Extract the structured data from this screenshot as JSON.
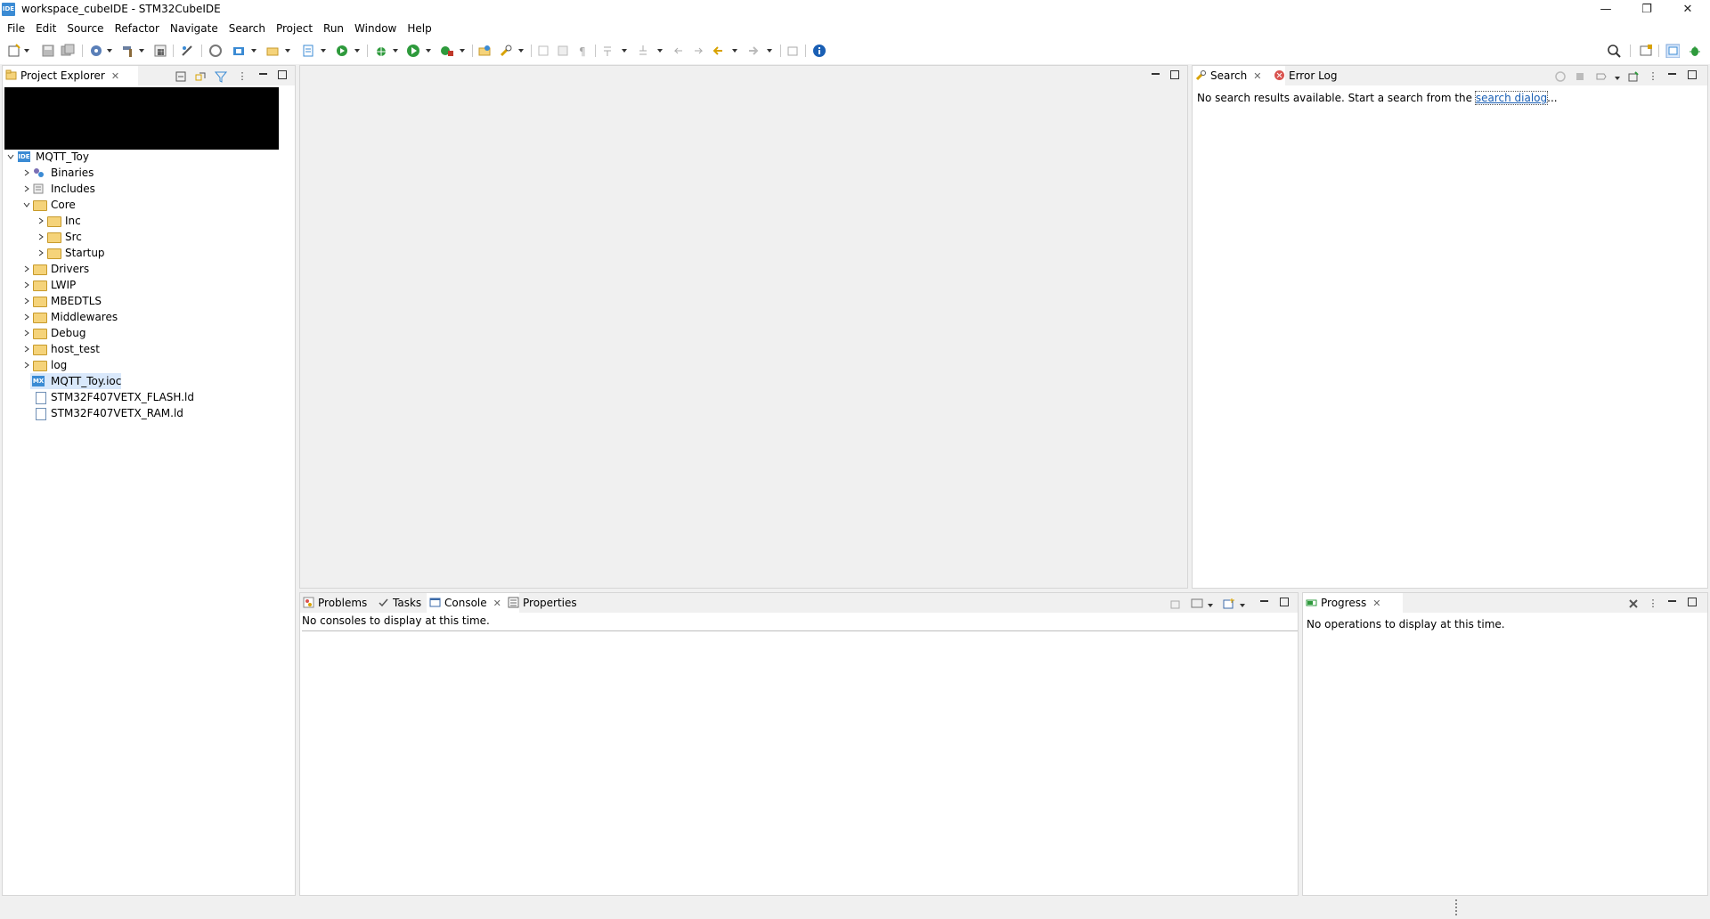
{
  "window": {
    "title": "workspace_cubeIDE - STM32CubeIDE",
    "app_icon_text": "IDE",
    "minimize": "—",
    "restore": "❐",
    "close": "✕"
  },
  "menu": [
    "File",
    "Edit",
    "Source",
    "Refactor",
    "Navigate",
    "Search",
    "Project",
    "Run",
    "Window",
    "Help"
  ],
  "project_explorer": {
    "tab_label": "Project Explorer",
    "tree": {
      "root": "MQTT_Toy",
      "items": [
        {
          "label": "Binaries"
        },
        {
          "label": "Includes"
        },
        {
          "label": "Core"
        },
        {
          "label": "Inc"
        },
        {
          "label": "Src"
        },
        {
          "label": "Startup"
        },
        {
          "label": "Drivers"
        },
        {
          "label": "LWIP"
        },
        {
          "label": "MBEDTLS"
        },
        {
          "label": "Middlewares"
        },
        {
          "label": "Debug"
        },
        {
          "label": "host_test"
        },
        {
          "label": "log"
        },
        {
          "label": "MQTT_Toy.ioc"
        },
        {
          "label": "STM32F407VETX_FLASH.ld"
        },
        {
          "label": "STM32F407VETX_RAM.ld"
        }
      ]
    },
    "ioc_icon_text": "MX"
  },
  "search_panel": {
    "tab_search": "Search",
    "tab_error_log": "Error Log",
    "message_prefix": "No search results available. Start a search from the ",
    "message_link": "search dialog",
    "message_suffix": "..."
  },
  "console_panel": {
    "tab_problems": "Problems",
    "tab_tasks": "Tasks",
    "tab_console": "Console",
    "tab_properties": "Properties",
    "message": "No consoles to display at this time."
  },
  "progress_panel": {
    "tab_progress": "Progress",
    "message": "No operations to display at this time."
  },
  "colors": {
    "accent": "#3b8bd4",
    "selection": "#d9e8fb",
    "link": "#1a5fb4"
  }
}
